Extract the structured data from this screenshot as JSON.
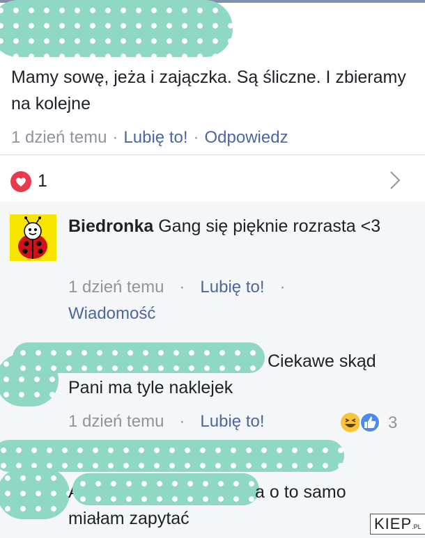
{
  "post": {
    "text": "Mamy sowę, jeża i zajączka. Są śliczne. I zbieramy na kolejne",
    "time": "1 dzień temu",
    "like": "Lubię to!",
    "reply": "Odpowiedz"
  },
  "reactions": {
    "count": "1",
    "icon": "heart-icon",
    "heart_color": "#e8394d"
  },
  "comments": [
    {
      "author": "Biedronka",
      "text": "Gang się pięknie rozrasta <3",
      "time": "1 dzień temu",
      "like": "Lubię to!",
      "message": "Wiadomość"
    },
    {
      "text_line1": "Ciekawe skąd",
      "text_line2": "Pani ma tyle naklejek",
      "time": "1 dzień temu",
      "like": "Lubię to!",
      "reaction_count": "3"
    },
    {
      "text_line1_prefix": "A",
      "text_line1_suffix": "a o to samo",
      "text_line2": "miałam zapytać"
    }
  ],
  "watermark": {
    "main": "KIEP",
    "suffix": ".PL"
  },
  "colors": {
    "link": "#4b67a1",
    "meta": "#90949c",
    "censor": "#8fd8c4",
    "comment_bg": "#f5f6f7"
  }
}
